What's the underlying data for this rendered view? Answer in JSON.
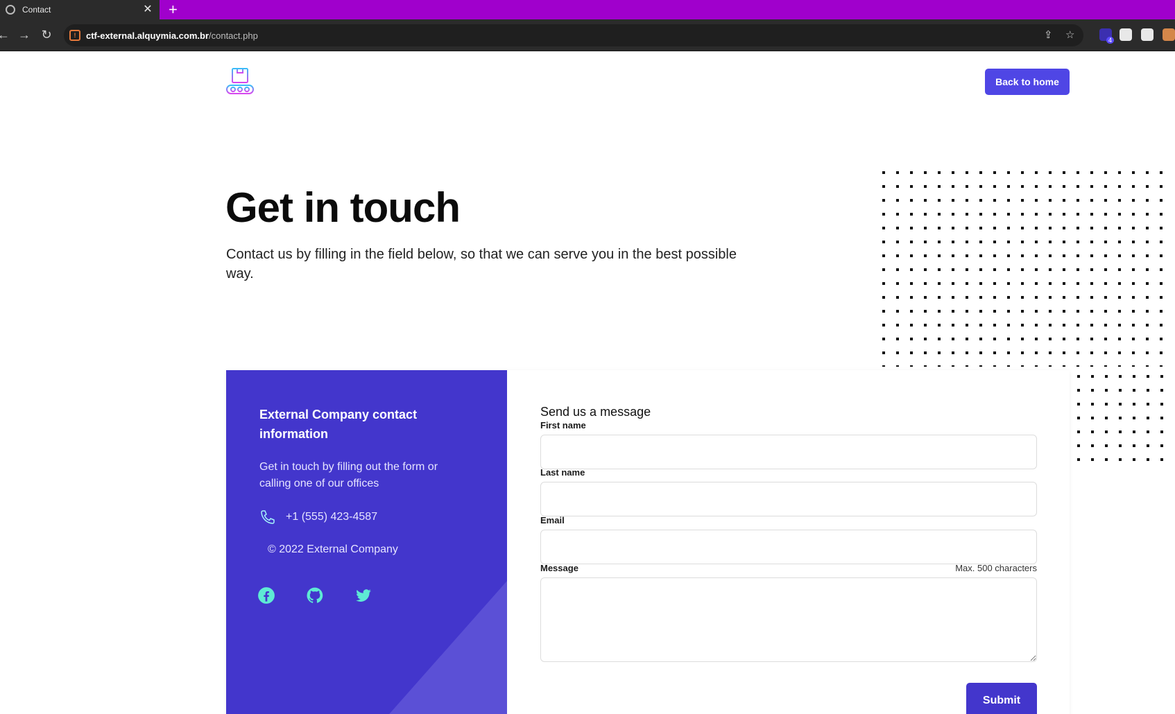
{
  "browser": {
    "tab_title": "Contact",
    "tab_close": "✕",
    "new_tab": "+",
    "url_host": "ctf-external.alquymia.com.br",
    "url_path": "/contact.php",
    "extension_badge": "4"
  },
  "header": {
    "logo_icon": "conveyor-box-icon",
    "back_button": "Back to home"
  },
  "hero": {
    "title": "Get in touch",
    "subtitle": "Contact us by filling in the field below, so that we can serve you in the best possible way."
  },
  "contact_info": {
    "title": "External Company contact information",
    "description": "Get in touch by filling out the form or calling one of our offices",
    "phone": "+1 (555) 423-4587",
    "copyright": "© 2022 External Company",
    "social": [
      "facebook-icon",
      "github-icon",
      "twitter-icon"
    ]
  },
  "form": {
    "title": "Send us a message",
    "first_name_label": "First name",
    "first_name_value": "",
    "last_name_label": "Last name",
    "last_name_value": "",
    "email_label": "Email",
    "email_value": "",
    "message_label": "Message",
    "message_hint": "Max. 500 characters",
    "message_value": "",
    "submit": "Submit"
  },
  "colors": {
    "accent": "#4f46e5",
    "panel": "#4336cc",
    "tab_strip": "#a000cc",
    "social_icon": "#5eead4"
  }
}
